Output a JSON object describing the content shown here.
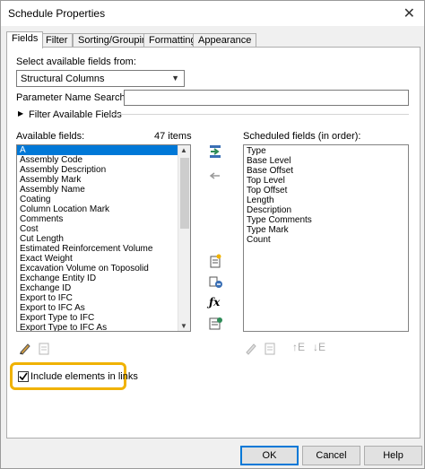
{
  "window": {
    "title": "Schedule Properties",
    "close_glyph": "✕"
  },
  "tabs": [
    {
      "label": "Fields",
      "active": true
    },
    {
      "label": "Filter"
    },
    {
      "label": "Sorting/Grouping"
    },
    {
      "label": "Formatting"
    },
    {
      "label": "Appearance"
    }
  ],
  "fields_tab": {
    "select_from_label": "Select available fields from:",
    "select_from_value": "Structural Columns",
    "param_search_label": "Parameter Name Search:",
    "param_search_value": "",
    "filter_available_label": "Filter Available Fields",
    "available_label": "Available fields:",
    "available_count": "47 items",
    "scheduled_label": "Scheduled fields (in order):",
    "available_fields": [
      "A",
      "Assembly Code",
      "Assembly Description",
      "Assembly Mark",
      "Assembly Name",
      "Coating",
      "Column Location Mark",
      "Comments",
      "Cost",
      "Cut Length",
      "Estimated Reinforcement Volume",
      "Exact Weight",
      "Excavation Volume on Toposolid",
      "Exchange Entity ID",
      "Exchange ID",
      "Export to IFC",
      "Export to IFC As",
      "Export Type to IFC",
      "Export Type to IFC As"
    ],
    "selected_available": "A",
    "scheduled_fields": [
      "Type",
      "Base Level",
      "Base Offset",
      "Top Level",
      "Top Offset",
      "Length",
      "Description",
      "Type Comments",
      "Type Mark",
      "Count"
    ],
    "include_links_label": "Include elements in links",
    "include_links_checked": true
  },
  "buttons": {
    "ok": "OK",
    "cancel": "Cancel",
    "help": "Help"
  },
  "icons": {
    "add": "add-parameter-icon",
    "remove": "remove-parameter-icon",
    "new_param": "new-parameter-icon",
    "combine": "combine-parameters-icon",
    "calculated": "calculated-value-icon",
    "edit": "edit-parameter-icon",
    "move_up": "move-up-icon",
    "move_down": "move-down-icon"
  },
  "colors": {
    "accent": "#0078d7",
    "highlight": "#f0b200",
    "icon_green": "#2e8b57",
    "icon_blue": "#3a6fb5"
  }
}
